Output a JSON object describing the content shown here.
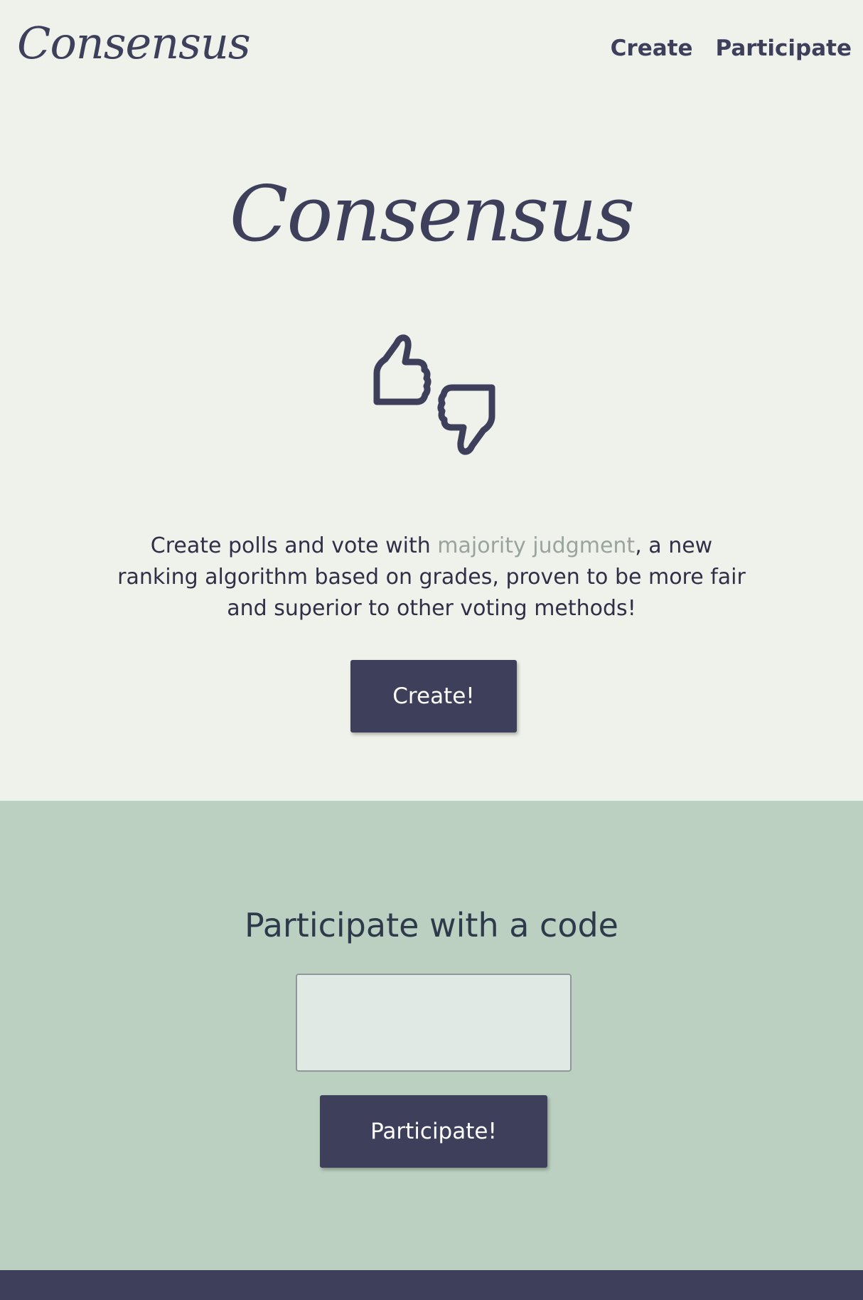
{
  "header": {
    "logo": "Consensus",
    "nav": [
      {
        "label": "Create"
      },
      {
        "label": "Participate"
      }
    ]
  },
  "hero": {
    "title": "Consensus",
    "icon": "thumbs-up-down-icon",
    "description_before": "Create polls and vote with ",
    "description_link": "majority judgment",
    "description_after": ", a new ranking algorithm based on grades, proven to be more fair and superior to other voting methods!",
    "create_button": "Create!"
  },
  "participate": {
    "title": "Participate with a code",
    "code_value": "",
    "button": "Participate!"
  },
  "colors": {
    "page_background": "#eff2ea",
    "primary": "#3e3f5b",
    "participate_background": "#bbd0c0",
    "link": "#9aa39c"
  }
}
